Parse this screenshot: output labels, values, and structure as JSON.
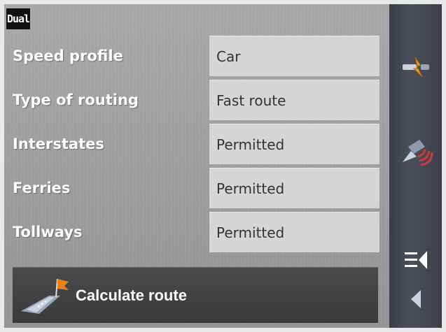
{
  "logo": {
    "text": "Dual"
  },
  "settings": [
    {
      "label": "Speed profile",
      "value": "Car"
    },
    {
      "label": "Type of routing",
      "value": "Fast route"
    },
    {
      "label": "Interstates",
      "value": "Permitted"
    },
    {
      "label": "Ferries",
      "value": "Permitted"
    },
    {
      "label": "Tollways",
      "value": "Permitted"
    }
  ],
  "calculate": {
    "label": "Calculate route",
    "icon": "route-flag-icon"
  },
  "sidebar": {
    "icons": [
      "route-options-icon",
      "gps-signal-icon",
      "menu-collapse-icon",
      "back-icon"
    ]
  },
  "colors": {
    "accent_orange": "#e8821a",
    "panel_bg": "#a3a3a3",
    "value_bg": "#d6d6d6",
    "sidebar_bg": "#434853"
  }
}
